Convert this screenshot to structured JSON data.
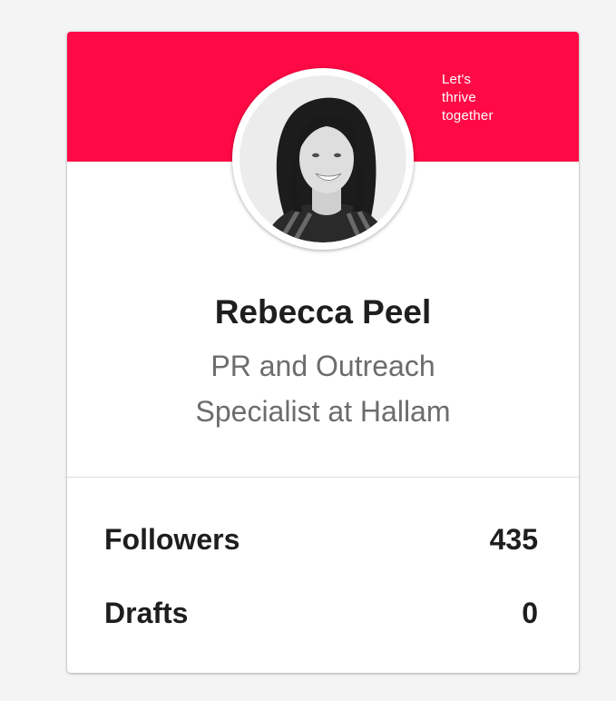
{
  "banner": {
    "color": "#ff0a45",
    "tagline_line1": "Let's",
    "tagline_line2": "thrive",
    "tagline_line3": "together"
  },
  "profile": {
    "name": "Rebecca Peel",
    "title_line1": "PR and Outreach",
    "title_line2": "Specialist at Hallam"
  },
  "stats": [
    {
      "label": "Followers",
      "value": "435"
    },
    {
      "label": "Drafts",
      "value": "0"
    }
  ],
  "colors": {
    "accent": "#ff0a45",
    "name_text": "#1e1e1e",
    "title_text": "#6c6c6c",
    "page_bg": "#f4f4f4"
  }
}
